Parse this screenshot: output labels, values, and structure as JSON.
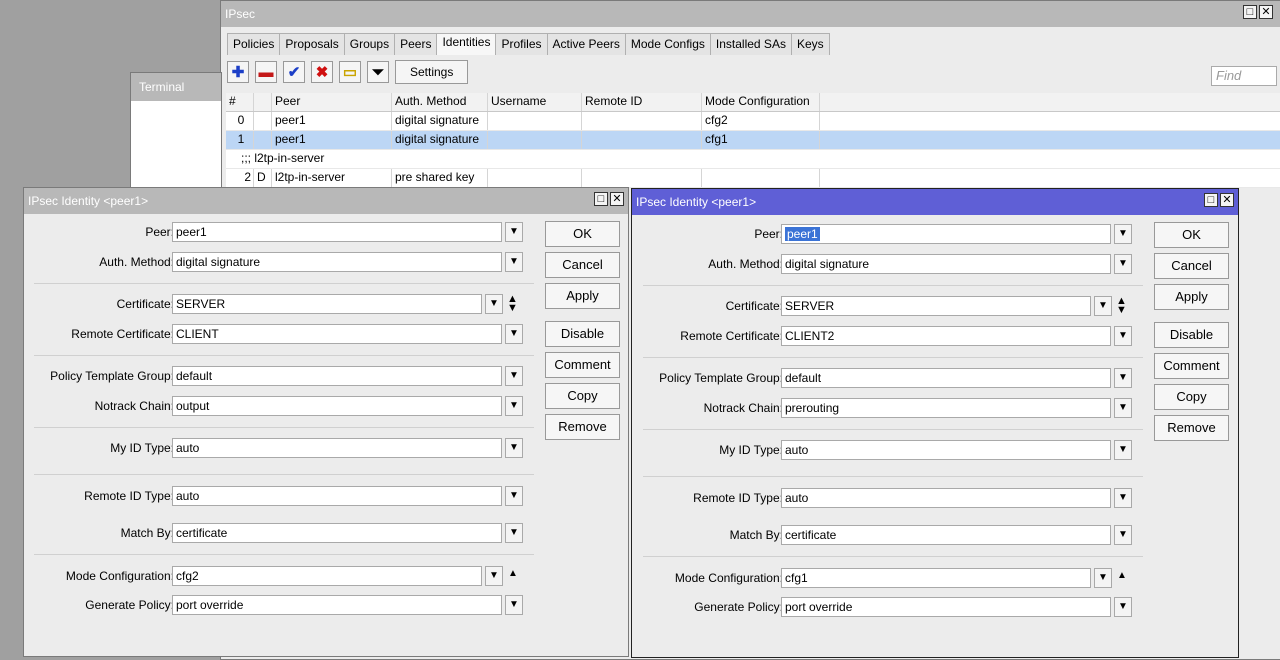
{
  "ipsec": {
    "title": "IPsec",
    "tabs": [
      "Policies",
      "Proposals",
      "Groups",
      "Peers",
      "Identities",
      "Profiles",
      "Active Peers",
      "Mode Configs",
      "Installed SAs",
      "Keys"
    ],
    "active_tab": "Identities",
    "settings_label": "Settings",
    "find_placeholder": "Find",
    "columns": [
      "#",
      "",
      "Peer",
      "Auth. Method",
      "Username",
      "Remote ID",
      "Mode Configuration",
      ""
    ],
    "rows": [
      {
        "num": "0",
        "flag": "",
        "peer": "peer1",
        "auth": "digital signature",
        "mode": "cfg2"
      },
      {
        "num": "1",
        "flag": "",
        "peer": "peer1",
        "auth": "digital signature",
        "mode": "cfg1"
      },
      {
        "comment": ";;; l2tp-in-server"
      },
      {
        "num": "2",
        "flag": "D",
        "peer": "l2tp-in-server",
        "auth": "pre shared key",
        "mode": ""
      }
    ]
  },
  "terminal": {
    "title": "Terminal"
  },
  "labels": {
    "peer": "Peer:",
    "auth_method": "Auth. Method:",
    "certificate": "Certificate:",
    "remote_certificate": "Remote Certificate:",
    "policy_template_group": "Policy Template Group:",
    "notrack_chain": "Notrack Chain:",
    "my_id_type": "My ID Type:",
    "remote_id_type": "Remote ID Type:",
    "match_by": "Match By:",
    "mode_configuration": "Mode Configuration:",
    "generate_policy": "Generate Policy:"
  },
  "buttons": {
    "ok": "OK",
    "cancel": "Cancel",
    "apply": "Apply",
    "disable": "Disable",
    "comment": "Comment",
    "copy": "Copy",
    "remove": "Remove"
  },
  "dialog1": {
    "title": "IPsec Identity <peer1>",
    "peer": "peer1",
    "auth_method": "digital signature",
    "certificate": "SERVER",
    "remote_certificate": "CLIENT",
    "policy_template_group": "default",
    "notrack_chain": "output",
    "my_id_type": "auto",
    "remote_id_type": "auto",
    "match_by": "certificate",
    "mode_configuration": "cfg2",
    "generate_policy": "port override"
  },
  "dialog2": {
    "title": "IPsec Identity <peer1>",
    "peer": "peer1",
    "auth_method": "digital signature",
    "certificate": "SERVER",
    "remote_certificate": "CLIENT2",
    "policy_template_group": "default",
    "notrack_chain": "prerouting",
    "my_id_type": "auto",
    "remote_id_type": "auto",
    "match_by": "certificate",
    "mode_configuration": "cfg1",
    "generate_policy": "port override"
  }
}
